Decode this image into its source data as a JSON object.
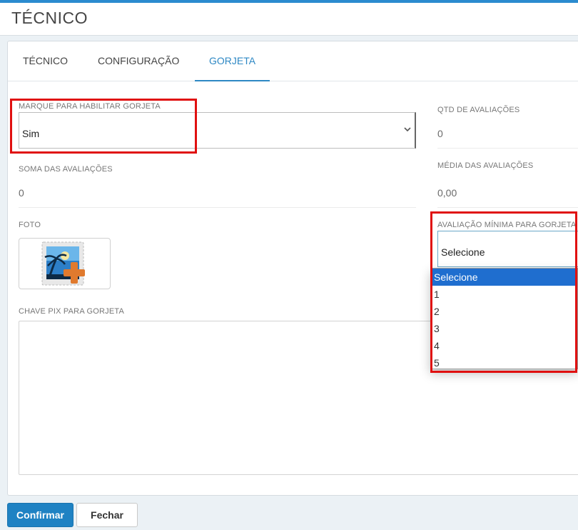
{
  "header": {
    "title": "TÉCNICO"
  },
  "tabs": [
    {
      "label": "TÉCNICO",
      "active": false
    },
    {
      "label": "CONFIGURAÇÃO",
      "active": false
    },
    {
      "label": "GORJETA",
      "active": true
    }
  ],
  "form": {
    "enable_tip": {
      "label": "MARQUE PARA HABILITAR GORJETA",
      "value": "Sim"
    },
    "sum_ratings": {
      "label": "SOMA DAS AVALIAÇÕES",
      "value": "0"
    },
    "photo": {
      "label": "FOTO",
      "icon": "add-photo-icon"
    },
    "pix_key": {
      "label": "CHAVE PIX PARA GORJETA",
      "value": ""
    },
    "qty_ratings": {
      "label": "QTD DE AVALIAÇÕES",
      "value": "0"
    },
    "avg_ratings": {
      "label": "MÉDIA DAS AVALIAÇÕES",
      "value": "0,00"
    },
    "min_rating": {
      "label": "AVALIAÇÃO MÍNIMA PARA GORJETA",
      "value": "Selecione",
      "options": [
        "Selecione",
        "1",
        "2",
        "3",
        "4",
        "5"
      ],
      "highlighted_option": "Selecione"
    }
  },
  "buttons": {
    "confirm": "Confirmar",
    "close": "Fechar"
  },
  "colors": {
    "accent": "#2e88c4",
    "primary_button": "#1f82c3",
    "highlight_box": "#e01010",
    "option_selected": "#1f6ecf"
  }
}
